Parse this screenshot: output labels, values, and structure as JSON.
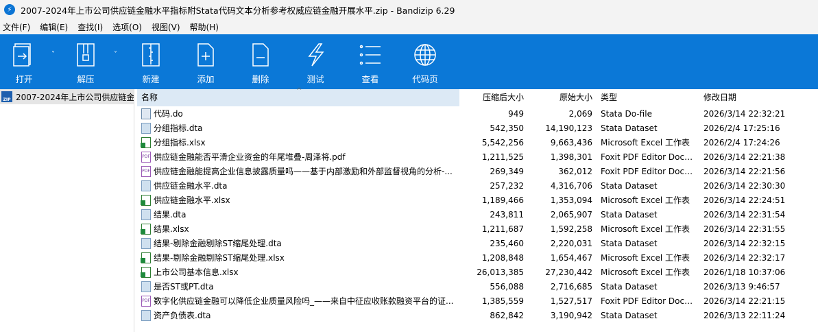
{
  "window": {
    "title": "2007-2024年上市公司供应链金融水平指标附Stata代码文本分析参考权威应链金融开展水平.zip - Bandizip 6.29"
  },
  "menu": [
    "文件(F)",
    "编辑(E)",
    "查找(I)",
    "选项(O)",
    "视图(V)",
    "帮助(H)"
  ],
  "toolbar": [
    {
      "label": "打开",
      "icon": "open-icon"
    },
    {
      "label": "解压",
      "icon": "extract-icon"
    },
    {
      "label": "新建",
      "icon": "new-archive-icon"
    },
    {
      "label": "添加",
      "icon": "add-file-icon"
    },
    {
      "label": "删除",
      "icon": "delete-file-icon"
    },
    {
      "label": "测试",
      "icon": "test-icon"
    },
    {
      "label": "查看",
      "icon": "view-list-icon"
    },
    {
      "label": "代码页",
      "icon": "globe-icon"
    }
  ],
  "tree": {
    "root": "2007-2024年上市公司供应链金"
  },
  "columns": [
    "名称",
    "压缩后大小",
    "原始大小",
    "类型",
    "修改日期"
  ],
  "files": [
    {
      "name": "代码.do",
      "kind": "do",
      "packed": "949",
      "size": "2,069",
      "type": "Stata Do-file",
      "date": "2026/3/14 22:32:21"
    },
    {
      "name": "分组指标.dta",
      "kind": "dta",
      "packed": "542,350",
      "size": "14,190,123",
      "type": "Stata Dataset",
      "date": "2026/2/4 17:25:16"
    },
    {
      "name": "分组指标.xlsx",
      "kind": "xlsx",
      "packed": "5,542,256",
      "size": "9,663,436",
      "type": "Microsoft Excel 工作表",
      "date": "2026/2/4 17:24:26"
    },
    {
      "name": "供应链金融能否平滑企业资金的年尾堆叠-周泽将.pdf",
      "kind": "pdf",
      "packed": "1,211,525",
      "size": "1,398,301",
      "type": "Foxit PDF Editor Docu...",
      "date": "2026/3/14 22:21:38"
    },
    {
      "name": "供应链金融能提高企业信息披露质量吗——基于内部激励和外部监督视角的分析-...",
      "kind": "pdf",
      "packed": "269,349",
      "size": "362,012",
      "type": "Foxit PDF Editor Docu...",
      "date": "2026/3/14 22:21:56"
    },
    {
      "name": "供应链金融水平.dta",
      "kind": "dta",
      "packed": "257,232",
      "size": "4,316,706",
      "type": "Stata Dataset",
      "date": "2026/3/14 22:30:30"
    },
    {
      "name": "供应链金融水平.xlsx",
      "kind": "xlsx",
      "packed": "1,189,466",
      "size": "1,353,094",
      "type": "Microsoft Excel 工作表",
      "date": "2026/3/14 22:24:51"
    },
    {
      "name": "结果.dta",
      "kind": "dta",
      "packed": "243,811",
      "size": "2,065,907",
      "type": "Stata Dataset",
      "date": "2026/3/14 22:31:54"
    },
    {
      "name": "结果.xlsx",
      "kind": "xlsx",
      "packed": "1,211,687",
      "size": "1,592,258",
      "type": "Microsoft Excel 工作表",
      "date": "2026/3/14 22:31:55"
    },
    {
      "name": "结果-剔除金融剔除ST缩尾处理.dta",
      "kind": "dta",
      "packed": "235,460",
      "size": "2,220,031",
      "type": "Stata Dataset",
      "date": "2026/3/14 22:32:15"
    },
    {
      "name": "结果-剔除金融剔除ST缩尾处理.xlsx",
      "kind": "xlsx",
      "packed": "1,208,848",
      "size": "1,654,467",
      "type": "Microsoft Excel 工作表",
      "date": "2026/3/14 22:32:17"
    },
    {
      "name": "上市公司基本信息.xlsx",
      "kind": "xlsx",
      "packed": "26,013,385",
      "size": "27,230,442",
      "type": "Microsoft Excel 工作表",
      "date": "2026/1/18 10:37:06"
    },
    {
      "name": "是否ST或PT.dta",
      "kind": "dta",
      "packed": "556,088",
      "size": "2,716,685",
      "type": "Stata Dataset",
      "date": "2026/3/13 9:46:57"
    },
    {
      "name": "数字化供应链金融可以降低企业质量风险吗_——来自中征应收账款融资平台的证...",
      "kind": "pdf",
      "packed": "1,385,559",
      "size": "1,527,517",
      "type": "Foxit PDF Editor Docu...",
      "date": "2026/3/14 22:21:15"
    },
    {
      "name": "资产负债表.dta",
      "kind": "dta",
      "packed": "862,842",
      "size": "3,190,942",
      "type": "Stata Dataset",
      "date": "2026/3/13 22:11:24"
    }
  ]
}
